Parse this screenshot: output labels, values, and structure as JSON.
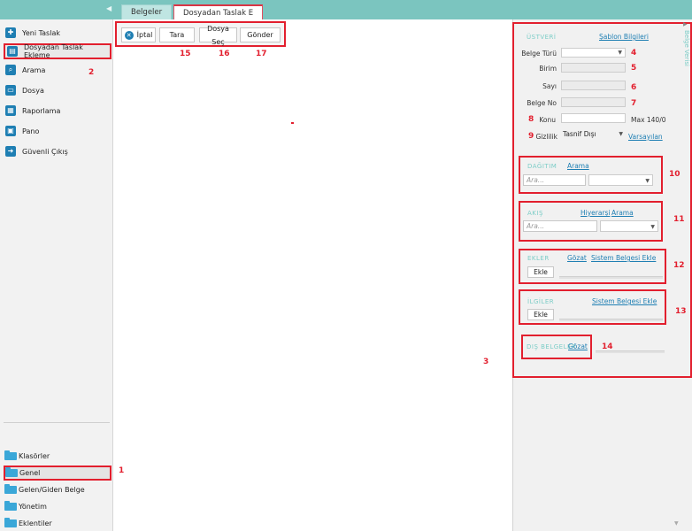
{
  "tabs": [
    {
      "label": "Belgeler"
    },
    {
      "label": "Dosyadan Taslak E"
    }
  ],
  "sidebar": {
    "items": [
      {
        "label": "Yeni Taslak",
        "icon": "new-draft-icon"
      },
      {
        "label": "Dosyadan Taslak Ekleme",
        "icon": "file-draft-icon"
      },
      {
        "label": "Arama",
        "icon": "search-icon"
      },
      {
        "label": "Dosya",
        "icon": "file-icon"
      },
      {
        "label": "Raporlama",
        "icon": "report-icon"
      },
      {
        "label": "Pano",
        "icon": "board-icon"
      },
      {
        "label": "Güvenli Çıkış",
        "icon": "logout-icon"
      }
    ],
    "folders": [
      {
        "label": "Klasörler"
      },
      {
        "label": "Genel"
      },
      {
        "label": "Gelen/Giden Belge"
      },
      {
        "label": "Yönetim"
      },
      {
        "label": "Eklentiler"
      }
    ]
  },
  "toolbar": {
    "cancel_label": "İptal",
    "scan_label": "Tara",
    "choose_file_label": "Dosya Seç",
    "send_label": "Gönder"
  },
  "metadata": {
    "title": "ÜSTVERİ",
    "template_link": "Şablon Bilgileri",
    "belge_turu_label": "Belge Türü",
    "birim_label": "Birim",
    "sayi_label": "Sayı",
    "belge_no_label": "Belge No",
    "konu_label": "Konu",
    "konu_max": "Max 140/0",
    "gizlilik_label": "Gizlilik",
    "gizlilik_value": "Tasnif Dışı",
    "default_link": "Varsayılan",
    "side_tab": "Belge Verisi"
  },
  "dagitim": {
    "title": "DAĞITIM",
    "search_link": "Arama",
    "placeholder": "Ara..."
  },
  "akis": {
    "title": "AKIŞ",
    "hierarchy_link": "Hiyerarşi",
    "search_link": "Arama",
    "placeholder": "Ara..."
  },
  "ekler": {
    "title": "EKLER",
    "browse_link": "Gözat",
    "system_link": "Sistem Belgesi Ekle",
    "add_label": "Ekle"
  },
  "ilgiler": {
    "title": "İLGİLER",
    "system_link": "Sistem Belgesi Ekle",
    "add_label": "Ekle"
  },
  "dis_belgeler": {
    "title": "DIŞ BELGELER",
    "browse_link": "Gözat"
  },
  "markers": {
    "m1": "1",
    "m2": "2",
    "m3": "3",
    "m4": "4",
    "m5": "5",
    "m6": "6",
    "m7": "7",
    "m8": "8",
    "m9": "9",
    "m10": "10",
    "m11": "11",
    "m12": "12",
    "m13": "13",
    "m14": "14",
    "m15": "15",
    "m16": "16",
    "m17": "17"
  },
  "colors": {
    "accent": "#7bc5bf",
    "highlight": "#e21f2e",
    "icon_blue": "#1f7fb3"
  }
}
